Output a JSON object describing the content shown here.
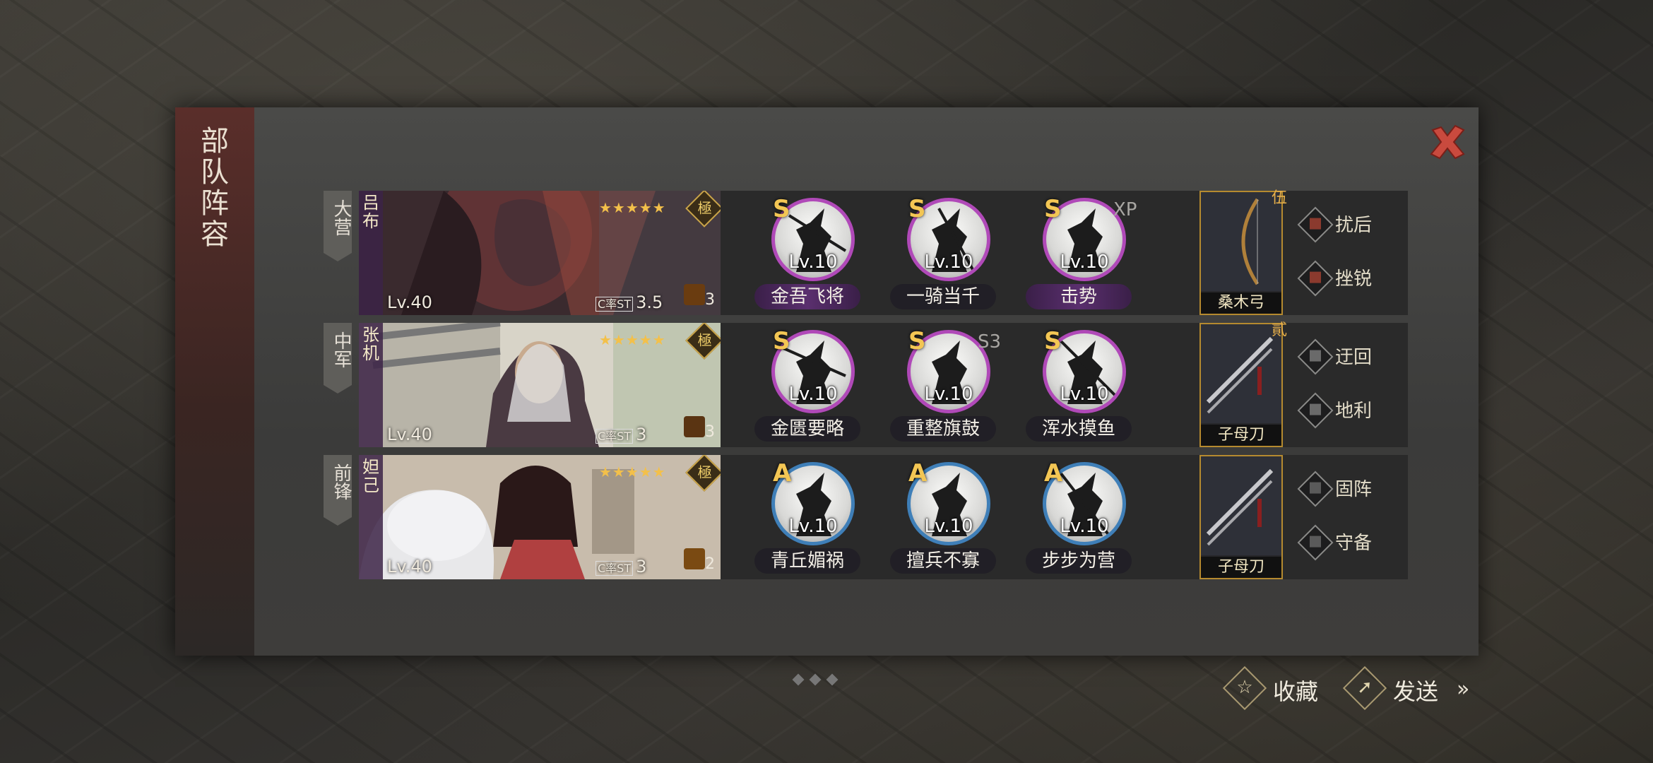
{
  "panel": {
    "title": "部队阵容",
    "close_icon": "close-icon"
  },
  "rows": [
    {
      "position": "大营",
      "hero": {
        "name": "吕布",
        "stars": "★★★★★",
        "rank": "極",
        "level": "Lv.40",
        "cost_label": "C率ST",
        "cost": "3.5",
        "troop_count": "3",
        "art_color": "#7a3a3a"
      },
      "skills": [
        {
          "grade": "S",
          "level": "Lv.10",
          "name": "金吾飞将",
          "extra": ""
        },
        {
          "grade": "S",
          "level": "Lv.10",
          "name": "一骑当千",
          "extra": ""
        },
        {
          "grade": "S",
          "level": "Lv.10",
          "name": "击势",
          "extra": "XP"
        }
      ],
      "weapon": {
        "name": "桑木弓",
        "tag": "伍"
      },
      "tactics": [
        "扰后",
        "挫锐"
      ]
    },
    {
      "position": "中军",
      "hero": {
        "name": "张机",
        "stars": "★★★★★",
        "rank": "極",
        "level": "Lv.40",
        "cost_label": "C率ST",
        "cost": "3",
        "troop_count": "3",
        "art_color": "#8a8478"
      },
      "skills": [
        {
          "grade": "S",
          "level": "Lv.10",
          "name": "金匮要略",
          "extra": ""
        },
        {
          "grade": "S",
          "level": "Lv.10",
          "name": "重整旗鼓",
          "extra": "S3"
        },
        {
          "grade": "S",
          "level": "Lv.10",
          "name": "浑水摸鱼",
          "extra": ""
        }
      ],
      "weapon": {
        "name": "子母刀",
        "tag": "貳"
      },
      "tactics": [
        "迂回",
        "地利"
      ]
    },
    {
      "position": "前锋",
      "hero": {
        "name": "妲己",
        "stars": "★★★★★",
        "rank": "極",
        "level": "Lv.40",
        "cost_label": "C率ST",
        "cost": "3",
        "troop_count": "2",
        "art_color": "#9a4a44"
      },
      "skills": [
        {
          "grade": "A",
          "level": "Lv.10",
          "name": "青丘媚祸",
          "extra": ""
        },
        {
          "grade": "A",
          "level": "Lv.10",
          "name": "擅兵不寡",
          "extra": ""
        },
        {
          "grade": "A",
          "level": "Lv.10",
          "name": "步步为营",
          "extra": ""
        }
      ],
      "weapon": {
        "name": "子母刀",
        "tag": ""
      },
      "tactics": [
        "固阵",
        "守备"
      ]
    }
  ],
  "bottom": {
    "favorite_label": "收藏",
    "favorite_icon": "star-icon",
    "send_label": "发送",
    "send_icon": "share-icon",
    "more_label": "»"
  },
  "colors": {
    "accent_gold": "#f3c654",
    "skill_purple": "#b049b8",
    "skill_blue": "#3f7fb8",
    "close_red": "#c94a3e"
  }
}
